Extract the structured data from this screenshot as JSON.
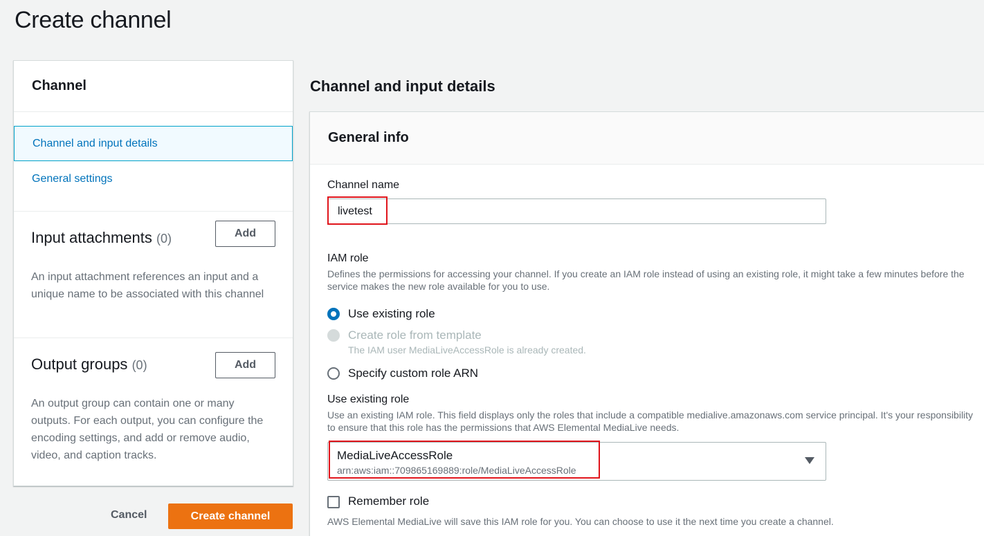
{
  "page": {
    "title": "Create channel"
  },
  "left_panel": {
    "header": "Channel",
    "nav": [
      {
        "label": "Channel and input details",
        "active": true
      },
      {
        "label": "General settings",
        "active": false
      }
    ],
    "input_attachments": {
      "title": "Input attachments",
      "count": "(0)",
      "add_label": "Add",
      "description": "An input attachment references an input and a unique name to be associated with this channel"
    },
    "output_groups": {
      "title": "Output groups",
      "count": "(0)",
      "add_label": "Add",
      "description": "An output group can contain one or many outputs. For each output, you can configure the encoding settings, and add or remove audio, video, and caption tracks."
    }
  },
  "actions": {
    "cancel_label": "Cancel",
    "create_label": "Create channel"
  },
  "main": {
    "heading": "Channel and input details",
    "general_info": {
      "title": "General info",
      "channel_name_label": "Channel name",
      "channel_name_value": "livetest",
      "iam_role_label": "IAM role",
      "iam_role_description": "Defines the permissions for accessing your channel. If you create an IAM role instead of using an existing role, it might take a few minutes before the service makes the new role available for you to use.",
      "role_options": [
        {
          "label": "Use existing role",
          "checked": true,
          "disabled": false
        },
        {
          "label": "Create role from template",
          "checked": false,
          "disabled": true,
          "sublabel": "The IAM user MediaLiveAccessRole is already created."
        },
        {
          "label": "Specify custom role ARN",
          "checked": false,
          "disabled": false
        }
      ],
      "existing_role_label": "Use existing role",
      "existing_role_description": "Use an existing IAM role. This field displays only the roles that include a compatible medialive.amazonaws.com service principal. It's your responsibility to ensure that this role has the permissions that AWS Elemental MediaLive needs.",
      "selected_role": {
        "name": "MediaLiveAccessRole",
        "arn": "arn:aws:iam::709865169889:role/MediaLiveAccessRole"
      },
      "remember_role_label": "Remember role",
      "remember_role_description": "AWS Elemental MediaLive will save this IAM role for you. You can choose to use it the next time you create a channel."
    }
  },
  "colors": {
    "accent": "#0073bb",
    "primary_button": "#ec7211",
    "highlight": "#e0141b"
  }
}
